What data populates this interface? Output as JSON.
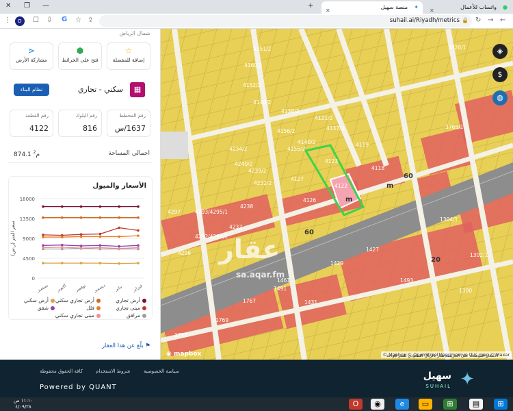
{
  "browser": {
    "tabs": [
      {
        "title": "واتساب للأعمال"
      },
      {
        "title": "منصة سهيل"
      }
    ],
    "url": "suhail.ai/Riyadh/metrics"
  },
  "sidebar": {
    "region": "شمال الرياض",
    "actions": [
      {
        "label": "إضافة للمفضلة",
        "icon": "star-icon"
      },
      {
        "label": "فتح على الخرائط",
        "icon": "map-pin-icon"
      },
      {
        "label": "مشاركة الأرض",
        "icon": "share-icon"
      }
    ],
    "build_button": "نظام البناء",
    "usage": "سكني - تجاري",
    "info": [
      {
        "label": "رقم المخطط",
        "value": "1637/س"
      },
      {
        "label": "رقم البلوك",
        "value": "816"
      },
      {
        "label": "رقم القطعة",
        "value": "4122"
      }
    ],
    "area_label": "اجمالي المساحة",
    "area_value": "874.1",
    "area_unit": "م",
    "price_title": "الأسعار والميول",
    "report_link": "بلّغ عن هذا العقار"
  },
  "chart_data": {
    "type": "line",
    "title": "الأسعار والميول",
    "ylabel": "سعر المتر (ر.س)",
    "ylim": [
      0,
      18000
    ],
    "yticks": [
      "18000",
      "13500",
      "9000",
      "4500",
      "0"
    ],
    "categories": [
      "سبتمبر",
      "أكتوبر",
      "نوفمبر",
      "ديسمبر",
      "يناير",
      "فبراير"
    ],
    "series": [
      {
        "name": "أرض تجاري",
        "color": "#7a1234",
        "values": [
          16200,
          16200,
          16200,
          16200,
          16200,
          16200
        ]
      },
      {
        "name": "أرض تجاري سكني",
        "color": "#d2691e",
        "values": [
          13700,
          13700,
          13700,
          13700,
          13700,
          13700
        ]
      },
      {
        "name": "أرض سكني",
        "color": "#d9a441",
        "values": [
          3400,
          3400,
          3400,
          3400,
          3300,
          3400
        ]
      },
      {
        "name": "مبنى تجاري",
        "color": "#c0392b",
        "values": [
          9800,
          9700,
          9900,
          10000,
          11400,
          10800
        ]
      },
      {
        "name": "فلل",
        "color": "#e67e22",
        "values": [
          9300,
          9300,
          9400,
          9400,
          9400,
          9600
        ]
      },
      {
        "name": "شقق",
        "color": "#8e44ad",
        "values": [
          7400,
          7500,
          7300,
          7400,
          7200,
          7400
        ]
      },
      {
        "name": "مرافق",
        "color": "#9e9e9e",
        "values": [
          6600,
          6600,
          6700,
          6600,
          6600,
          6600
        ]
      },
      {
        "name": "مبنى تجاري سكني",
        "color": "#ec8f9b",
        "values": [
          6900,
          7000,
          6800,
          6900,
          6700,
          6900
        ]
      }
    ]
  },
  "map": {
    "watermark": "عقار",
    "watermark_url": "sa.aqar.fm",
    "logo": "mapbox",
    "attribution": "© Mapbox © OpenStreetMap Improve this map © Maxar",
    "note": "الأسعار الموضحة على الخريطة تقدر بالريال السعودي للمتر الواحد",
    "parcels": [
      {
        "label": "4122"
      },
      {
        "label": "4123"
      },
      {
        "label": "4126"
      },
      {
        "label": "4127"
      },
      {
        "label": "4118"
      },
      {
        "label": "4119"
      },
      {
        "label": "4121/2"
      },
      {
        "label": "4137/2"
      },
      {
        "label": "4140/2"
      },
      {
        "label": "4155/2"
      },
      {
        "label": "4156/2"
      },
      {
        "label": "4138/2"
      },
      {
        "label": "4237"
      },
      {
        "label": "4238"
      },
      {
        "label": "4239/2"
      },
      {
        "label": "4240/2"
      },
      {
        "label": "4234/2"
      },
      {
        "label": "4232/2"
      },
      {
        "label": "4292/4294/1"
      },
      {
        "label": "4293/4295/1"
      },
      {
        "label": "4297"
      },
      {
        "label": "4296"
      },
      {
        "label": "4151/2"
      },
      {
        "label": "4160/2"
      },
      {
        "label": "4152/2"
      },
      {
        "label": "4148/2"
      },
      {
        "label": "3820/1"
      },
      {
        "label": "3765/1"
      },
      {
        "label": "1304/1"
      },
      {
        "label": "1300"
      },
      {
        "label": "1427"
      },
      {
        "label": "1429"
      },
      {
        "label": "1431"
      },
      {
        "label": "1491"
      },
      {
        "label": "1767"
      },
      {
        "label": "1769"
      },
      {
        "label": "1771"
      },
      {
        "label": "1302/1"
      },
      {
        "label": "1461"
      },
      {
        "label": "1493"
      }
    ],
    "streets": [
      {
        "label": "60"
      },
      {
        "label": "60"
      },
      {
        "label": "20"
      },
      {
        "label": "m"
      },
      {
        "label": "m"
      }
    ]
  },
  "footer": {
    "links": [
      "سياسة الخصوصية",
      "شروط الاستخدام",
      "كافة الحقوق محفوظة"
    ],
    "powered": "Powered by QUANT",
    "brand_ar": "سهيل",
    "brand_en": "SUHAIL"
  },
  "taskbar": {
    "time": "١١:١٠ ص",
    "date": "٤/٠٩/٢٨"
  }
}
